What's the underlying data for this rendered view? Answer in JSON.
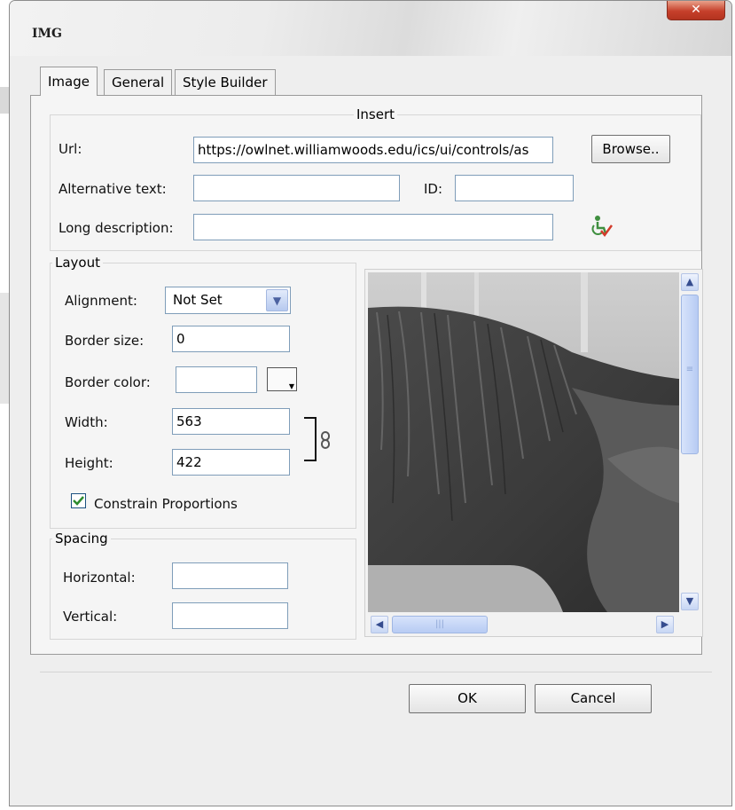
{
  "window": {
    "title": "IMG",
    "close_glyph": "✕"
  },
  "tabs": [
    {
      "label": "Image",
      "active": true
    },
    {
      "label": "General",
      "active": false
    },
    {
      "label": "Style Builder",
      "active": false
    }
  ],
  "insert": {
    "legend": "Insert",
    "url_label": "Url:",
    "url_value": "https://owlnet.williamwoods.edu/ics/ui/controls/as",
    "browse_label": "Browse..",
    "alt_label": "Alternative text:",
    "alt_value": "",
    "id_label": "ID:",
    "id_value": "",
    "longdesc_label": "Long description:",
    "longdesc_value": "",
    "accessibility_icon": "accessibility-check-icon"
  },
  "layout": {
    "legend": "Layout",
    "alignment_label": "Alignment:",
    "alignment_value": "Not Set",
    "border_size_label": "Border size:",
    "border_size_value": "0",
    "border_color_label": "Border color:",
    "border_color_value": "",
    "width_label": "Width:",
    "width_value": "563",
    "height_label": "Height:",
    "height_value": "422",
    "constrain_label": "Constrain Proportions",
    "constrain_checked": true,
    "link_icon": "chain-link-icon"
  },
  "spacing": {
    "legend": "Spacing",
    "horizontal_label": "Horizontal:",
    "horizontal_value": "",
    "vertical_label": "Vertical:",
    "vertical_value": ""
  },
  "buttons": {
    "ok": "OK",
    "cancel": "Cancel"
  },
  "colors": {
    "accent": "#7f9db9",
    "check": "#2e8b2e",
    "close": "#c6402b"
  }
}
